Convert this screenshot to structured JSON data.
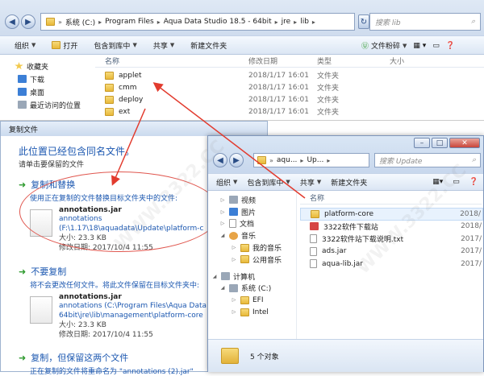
{
  "explorer1": {
    "address": [
      "系统 (C:)",
      "Program Files",
      "Aqua Data Studio 18.5 - 64bit",
      "jre",
      "lib"
    ],
    "search_placeholder": "搜索 lib",
    "toolbar": [
      "组织",
      "打开",
      "包含到库中",
      "共享",
      "新建文件夹"
    ],
    "right_tool": "文件粉碎",
    "sidebar": [
      "收藏夹",
      "下载",
      "桌面",
      "最近访问的位置"
    ],
    "columns": [
      "名称",
      "修改日期",
      "类型",
      "大小"
    ],
    "rows": [
      {
        "name": "applet",
        "date": "2018/1/17 16:01",
        "type": "文件夹"
      },
      {
        "name": "cmm",
        "date": "2018/1/17 16:01",
        "type": "文件夹"
      },
      {
        "name": "deploy",
        "date": "2018/1/17 16:01",
        "type": "文件夹"
      },
      {
        "name": "ext",
        "date": "2018/1/17 16:01",
        "type": "文件夹"
      }
    ]
  },
  "dialog": {
    "title": "复制文件",
    "heading": "此位置已经包含同名文件。",
    "subheading": "请单击要保留的文件",
    "opt1": {
      "title": "复制和替换",
      "desc": "使用正在复制的文件替换目标文件夹中的文件:",
      "file": "annotations.jar",
      "path1": "annotations",
      "path2": "(F:\\1.17\\18\\aquadata\\Update\\platform-c",
      "size": "大小: 23.3 KB",
      "date": "修改日期: 2017/10/4 11:55"
    },
    "opt2": {
      "title": "不要复制",
      "desc": "将不会更改任何文件。将此文件保留在目标文件夹中:",
      "file": "annotations.jar",
      "path1": "annotations (C:\\Program Files\\Aqua Data",
      "path2": "64bit\\jre\\lib\\management\\platform-core",
      "size": "大小: 23.3 KB",
      "date": "修改日期: 2017/10/4 11:55"
    },
    "opt3": {
      "title": "复制，但保留这两个文件",
      "desc": "正在复制的文件将重命名为 \"annotations (2).jar\""
    }
  },
  "explorer2": {
    "address": [
      "aqu...",
      "Up..."
    ],
    "search_placeholder": "搜索 Update",
    "toolbar": [
      "组织",
      "包含到库中",
      "共享",
      "新建文件夹"
    ],
    "sidebar": [
      {
        "label": "视频",
        "indent": 1
      },
      {
        "label": "图片",
        "indent": 1
      },
      {
        "label": "文档",
        "indent": 1
      },
      {
        "label": "音乐",
        "indent": 1
      },
      {
        "label": "我的音乐",
        "indent": 2
      },
      {
        "label": "公用音乐",
        "indent": 2
      },
      {
        "label": "计算机",
        "indent": 0
      },
      {
        "label": "系统 (C:)",
        "indent": 1
      },
      {
        "label": "EFI",
        "indent": 2
      },
      {
        "label": "Intel",
        "indent": 2
      }
    ],
    "column": "名称",
    "rows": [
      {
        "name": "platform-core",
        "date": "2018/"
      },
      {
        "name": "3322软件下载站",
        "date": "2018/"
      },
      {
        "name": "3322软件站下载说明.txt",
        "date": "2017/"
      },
      {
        "name": "ads.jar",
        "date": "2017/"
      },
      {
        "name": "aqua-lib.jar",
        "date": "2017/"
      }
    ],
    "status": "5 个对象"
  },
  "watermark": "WWW.3322.CC"
}
